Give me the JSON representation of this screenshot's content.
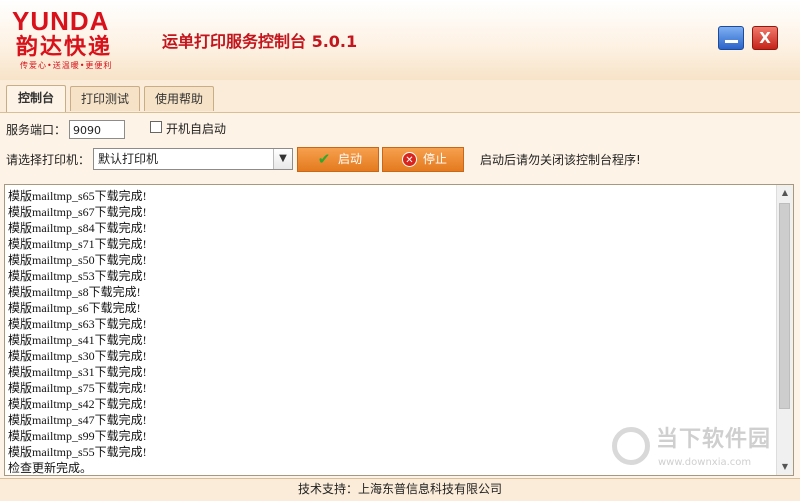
{
  "header": {
    "logo_brand": "YUNDA",
    "logo_cn": "韵达快递",
    "logo_slogan": "传爱心•送温暖•更便利",
    "title": "运单打印服务控制台 5.0.1",
    "close_glyph": "X"
  },
  "tabs": [
    {
      "label": "控制台"
    },
    {
      "label": "打印测试"
    },
    {
      "label": "使用帮助"
    }
  ],
  "form": {
    "port_label": "服务端口：",
    "port_value": "9090",
    "autostart_label": "开机自启动",
    "printer_label": "请选择打印机：",
    "printer_value": "默认打印机",
    "start_label": "启动",
    "stop_label": "停止",
    "hint": "启动后请勿关闭该控制台程序!"
  },
  "log": {
    "lines": [
      "模版mailtmp_s65下载完成!",
      "模版mailtmp_s67下载完成!",
      "模版mailtmp_s84下载完成!",
      "模版mailtmp_s71下载完成!",
      "模版mailtmp_s50下载完成!",
      "模版mailtmp_s53下载完成!",
      "模版mailtmp_s8下载完成!",
      "模版mailtmp_s6下载完成!",
      "模版mailtmp_s63下载完成!",
      "模版mailtmp_s41下载完成!",
      "模版mailtmp_s30下载完成!",
      "模版mailtmp_s31下载完成!",
      "模版mailtmp_s75下载完成!",
      "模版mailtmp_s42下载完成!",
      "模版mailtmp_s47下载完成!",
      "模版mailtmp_s99下载完成!",
      "模版mailtmp_s55下载完成!",
      "检查更新完成。"
    ]
  },
  "watermark": {
    "text": "当下软件园",
    "url": "www.downxia.com"
  },
  "footer": {
    "text": "技术支持：上海东普信息科技有限公司"
  },
  "colors": {
    "brand_red": "#d8111b",
    "button_orange": "#e47a1e",
    "background": "#fdf3e6"
  }
}
